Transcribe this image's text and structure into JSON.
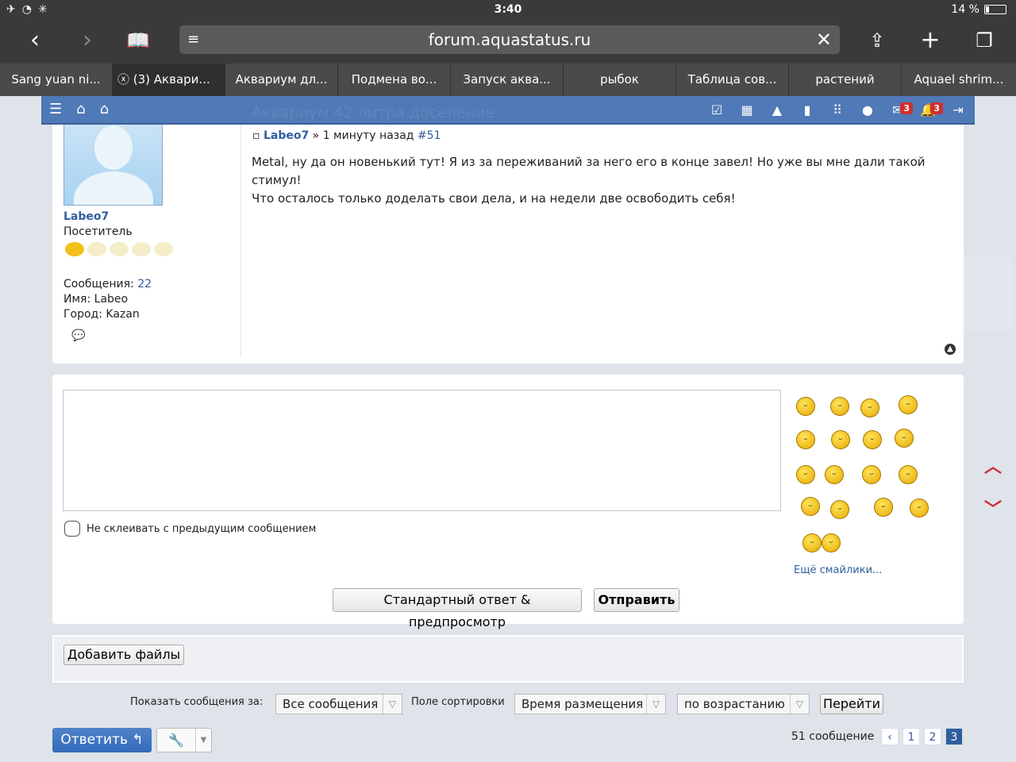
{
  "status": {
    "time": "3:40",
    "battery": "14 %"
  },
  "browser": {
    "url": "forum.aquastatus.ru",
    "tabs": [
      {
        "label": "Sang yuan ni..."
      },
      {
        "label": "(3) Аквари..."
      },
      {
        "label": "Аквариум дл..."
      },
      {
        "label": "Подмена во..."
      },
      {
        "label": "Запуск аква..."
      },
      {
        "label": "рыбок"
      },
      {
        "label": "Таблица сов..."
      },
      {
        "label": "растений"
      },
      {
        "label": "Aquael shrim..."
      }
    ]
  },
  "navbar": {
    "title": "Аквариум 42 литра доселение",
    "messages_badge": "3",
    "alerts_badge": "3"
  },
  "post": {
    "author": "Labeo7",
    "separator": "»",
    "time": "1 минуту назад",
    "number": "#51",
    "text_line1": "Metal, ну да он новенький тут! Я из за переживаний за него его в конце завел! Но уже вы мне дали такой стимул!",
    "text_line2": "Что осталось только доделать свои дела, и на недели две освободить себя!",
    "user": {
      "name": "Labeo7",
      "rank": "Посетитель",
      "messages_label": "Сообщения:",
      "messages_value": "22",
      "name_label": "Имя:",
      "name_value": "Labeo",
      "city_label": "Город:",
      "city_value": "Kazan",
      "rating_stars": 1,
      "rating_max": 5
    }
  },
  "reply": {
    "no_merge_label": "Не склеивать с предыдущим сообщением",
    "more_smilies": "Ещё смайлики...",
    "preview_button": "Стандартный ответ & предпросмотр",
    "send_button": "Отправить"
  },
  "attachments": {
    "add_files": "Добавить файлы"
  },
  "filters": {
    "show_label": "Показать сообщения за:",
    "show_value": "Все сообщения",
    "sort_label": "Поле сортировки",
    "sort_value": "Время размещения",
    "order_value": "по возрастанию",
    "go_button": "Перейти"
  },
  "footer": {
    "reply_button": "Ответить",
    "post_count": "51 сообщение",
    "pages": [
      "1",
      "2",
      "3"
    ],
    "current_page": "3"
  },
  "colors": {
    "accent": "#4f79b7",
    "link": "#2f5e9c",
    "badge": "#d0302f",
    "scroll_arrows": "#d2282e"
  }
}
